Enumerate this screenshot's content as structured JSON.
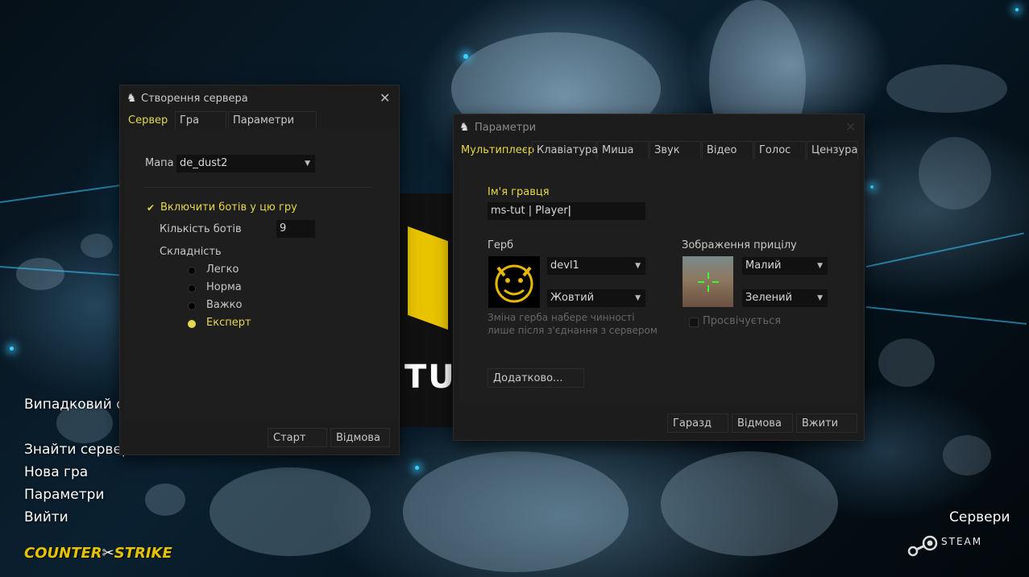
{
  "main_menu": {
    "items": [
      "Випадковий се",
      "Знайти сервер",
      "Нова гра",
      "Параметри",
      "Вийти"
    ],
    "servers_label": "Сервери",
    "logo_text": "CounterStrike",
    "steam_label": "STEAM"
  },
  "create_server": {
    "title": "Створення сервера",
    "tabs": [
      "Сервер",
      "Гра",
      "Параметри ботів"
    ],
    "map_label": "Мапа",
    "map_value": "de_dust2",
    "enable_bots_label": "Включити ботів у цю гру",
    "bot_count_label": "Кількість ботів",
    "bot_count_value": "9",
    "difficulty_label": "Складність",
    "difficulties": [
      "Легко",
      "Норма",
      "Важко",
      "Експерт"
    ],
    "selected_difficulty": "Експерт",
    "start_button": "Старт",
    "cancel_button": "Відмова"
  },
  "options": {
    "title": "Параметри",
    "tabs": [
      "Мультиплеєр",
      "Клавіатура",
      "Миша",
      "Звук",
      "Відео",
      "Голос",
      "Цензура"
    ],
    "player_name_label": "Ім'я гравця",
    "player_name_value": "ms-tut | Player",
    "spray_label": "Герб",
    "spray_value": "devl1",
    "spray_color": "Жовтий",
    "spray_note_line1": "Зміна герба набере чинності",
    "spray_note_line2": "лише після з'єднання з сервером",
    "crosshair_label": "Зображення прицілу",
    "crosshair_size": "Малий",
    "crosshair_color": "Зелений",
    "translucent_label": "Просвічується",
    "advanced_button": "Додатково...",
    "ok_button": "Гаразд",
    "cancel_button": "Відмова",
    "apply_button": "Вжити"
  },
  "colors": {
    "accent_yellow": "#e6d84a",
    "dialog_bg": "#1c1c1c"
  }
}
